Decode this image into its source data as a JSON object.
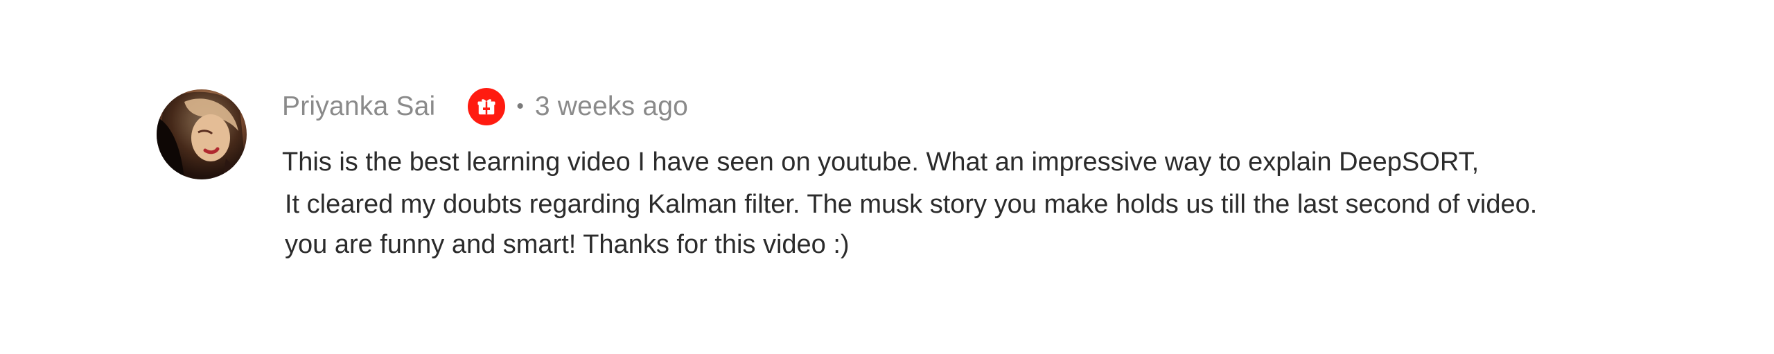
{
  "comment": {
    "author": "Priyanka Sai",
    "badge_icon": "member-badge-icon",
    "separator": "•",
    "timestamp": "3 weeks ago",
    "body_lines": [
      "This is the best learning video I have seen on youtube. What an impressive way to explain DeepSORT,",
      "It cleared my doubts regarding Kalman filter. The musk story you make holds us till the last second of video.",
      "you are funny and smart!  Thanks for this video :)"
    ]
  },
  "colors": {
    "badge": "#ff1b10",
    "author_text": "#8a8a8a",
    "body_text": "#2b2b2b"
  }
}
